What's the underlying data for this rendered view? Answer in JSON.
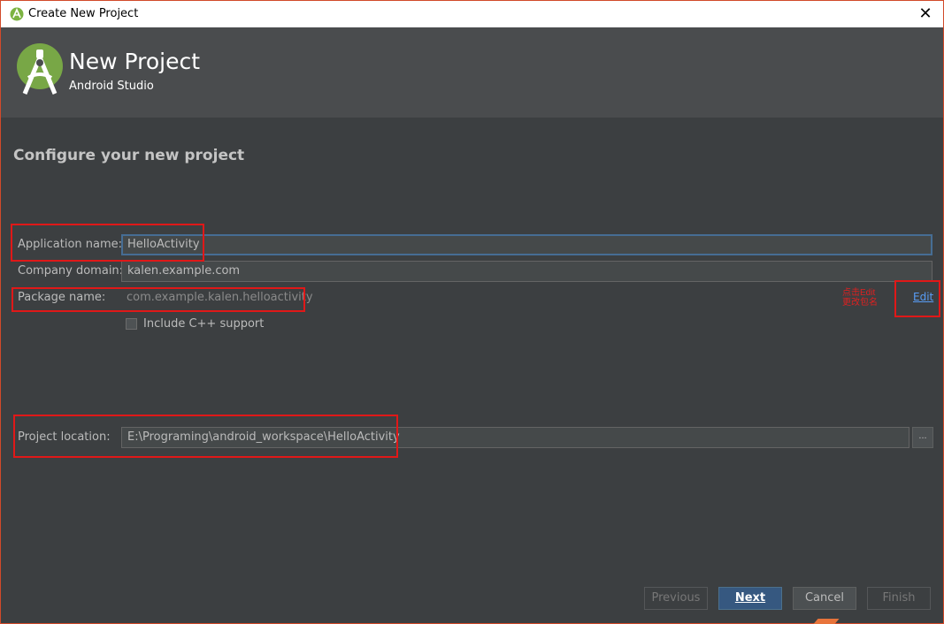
{
  "window": {
    "title": "Create New Project",
    "close_glyph": "✕"
  },
  "header": {
    "title": "New Project",
    "subtitle": "Android Studio"
  },
  "form": {
    "section_title": "Configure your new project",
    "application_name": {
      "label": "Application name:",
      "value": "HelloActivity"
    },
    "company_domain": {
      "label": "Company domain:",
      "value": "kalen.example.com"
    },
    "package_name": {
      "label": "Package name:",
      "value": "com.example.kalen.helloactivity",
      "edit_label": "Edit"
    },
    "annotation": {
      "line1": "点击Edit",
      "line2": "更改包名"
    },
    "cpp_support": {
      "label": "Include C++ support",
      "checked": false
    },
    "project_location": {
      "label": "Project location:",
      "value": "E:\\Programing\\android_workspace\\HelloActivity",
      "browse_label": "..."
    }
  },
  "buttons": {
    "previous": "Previous",
    "next": "Next",
    "cancel": "Cancel",
    "finish": "Finish"
  },
  "colors": {
    "background": "#3c3f41",
    "banner": "#4a4c4e",
    "accent": "#365880",
    "link": "#589df6",
    "highlight": "#e01818"
  }
}
